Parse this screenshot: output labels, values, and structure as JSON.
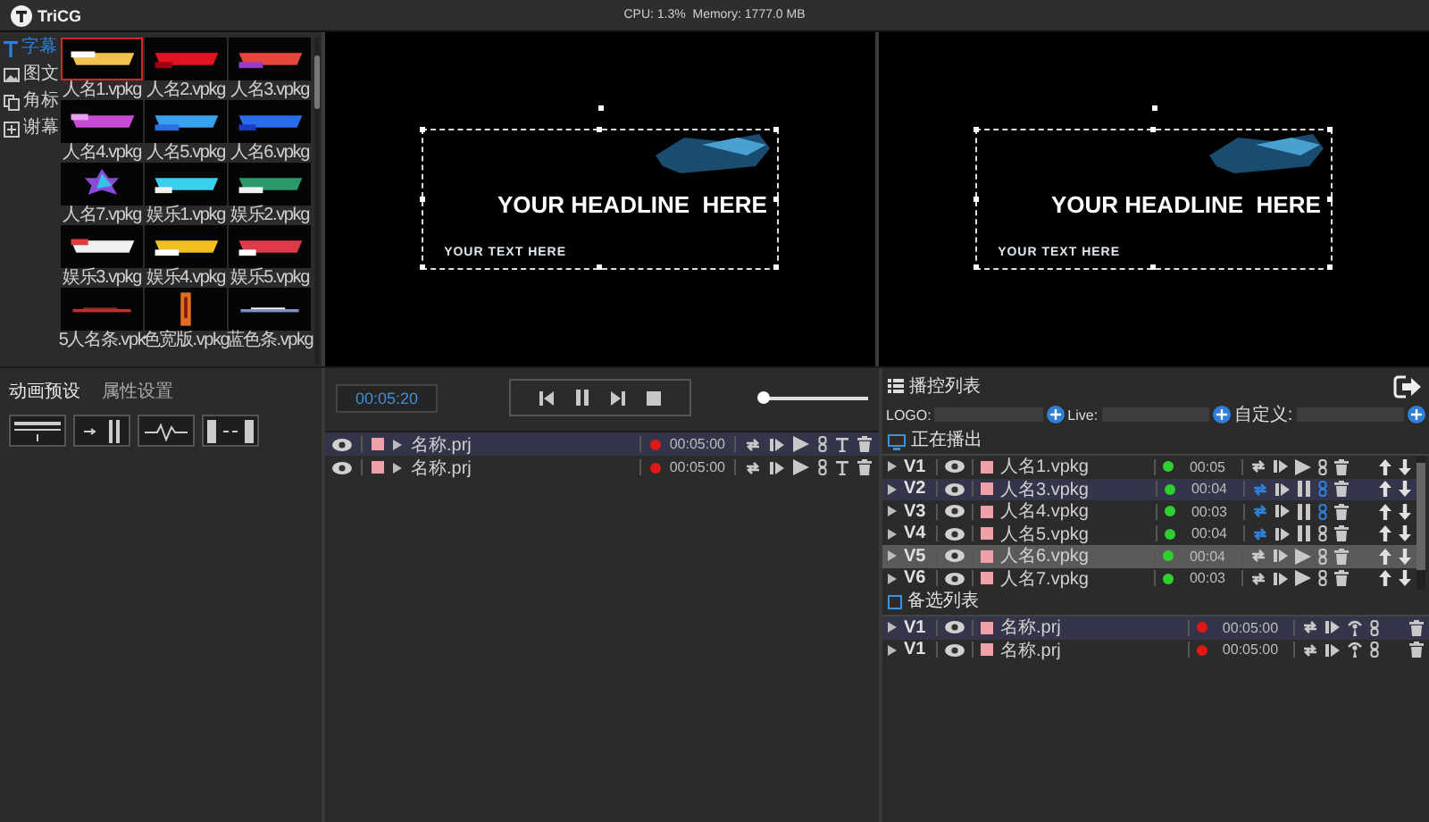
{
  "app": {
    "name": "TriCG",
    "status": "CPU: 1.3%  Memory: 1777.0 MB"
  },
  "library": {
    "tabs": [
      {
        "label": "字幕",
        "selected": true
      },
      {
        "label": "图文",
        "selected": false
      },
      {
        "label": "角标",
        "selected": false
      },
      {
        "label": "谢幕",
        "selected": false
      }
    ],
    "templates": [
      {
        "name": "人名1.vpkg",
        "selected": true
      },
      {
        "name": "人名2.vpkg",
        "selected": false
      },
      {
        "name": "人名3.vpkg",
        "selected": false
      },
      {
        "name": "人名4.vpkg",
        "selected": false
      },
      {
        "name": "人名5.vpkg",
        "selected": false
      },
      {
        "name": "人名6.vpkg",
        "selected": false
      },
      {
        "name": "人名7.vpkg",
        "selected": false
      },
      {
        "name": "娱乐1.vpkg",
        "selected": false
      },
      {
        "name": "娱乐2.vpkg",
        "selected": false
      },
      {
        "name": "娱乐3.vpkg",
        "selected": false
      },
      {
        "name": "娱乐4.vpkg",
        "selected": false
      },
      {
        "name": "娱乐5.vpkg",
        "selected": false
      },
      {
        "name": "5人名条.vpk",
        "selected": false
      },
      {
        "name": "色宽版.vpkg",
        "selected": false
      },
      {
        "name": "蓝色条.vpkg",
        "selected": false
      }
    ]
  },
  "previews": [
    {
      "headline": "YOUR HEADLINE  HERE",
      "subtitle": "YOUR TEXT HERE"
    },
    {
      "headline": "YOUR HEADLINE  HERE",
      "subtitle": "YOUR TEXT HERE"
    }
  ],
  "animation_panel": {
    "tabs": [
      {
        "label": "动画预设",
        "selected": true
      },
      {
        "label": "属性设置",
        "selected": false
      }
    ]
  },
  "timeline": {
    "time": "00:05:20",
    "volume": {
      "level": 0
    },
    "rows": [
      {
        "name": "名称.prj",
        "duration": "00:05:00",
        "focused": true
      },
      {
        "name": "名称.prj",
        "duration": "00:05:00",
        "focused": false
      }
    ]
  },
  "playlist": {
    "title": "播控列表",
    "fields": [
      {
        "label": "LOGO:"
      },
      {
        "label": "Live:"
      },
      {
        "label": "自定义:"
      }
    ],
    "on_air": {
      "title": "正在播出",
      "rows": [
        {
          "layer": "V1",
          "name": "人名1.vpkg",
          "time": "00:05",
          "playing": false,
          "loop": false,
          "linked": false,
          "selected": false,
          "focused": false
        },
        {
          "layer": "V2",
          "name": "人名3.vpkg",
          "time": "00:04",
          "playing": true,
          "loop": true,
          "linked": true,
          "selected": false,
          "focused": true
        },
        {
          "layer": "V3",
          "name": "人名4.vpkg",
          "time": "00:03",
          "playing": true,
          "loop": true,
          "linked": true,
          "selected": false,
          "focused": false
        },
        {
          "layer": "V4",
          "name": "人名5.vpkg",
          "time": "00:04",
          "playing": true,
          "loop": true,
          "linked": false,
          "selected": false,
          "focused": false
        },
        {
          "layer": "V5",
          "name": "人名6.vpkg",
          "time": "00:04",
          "playing": false,
          "loop": false,
          "linked": false,
          "selected": true,
          "focused": false
        },
        {
          "layer": "V6",
          "name": "人名7.vpkg",
          "time": "00:03",
          "playing": false,
          "loop": false,
          "linked": false,
          "selected": false,
          "focused": false
        }
      ]
    },
    "backup": {
      "title": "备选列表",
      "checked": false,
      "rows": [
        {
          "layer": "V1",
          "name": "名称.prj",
          "time": "00:05:00",
          "focused": true
        },
        {
          "layer": "V1",
          "name": "名称.prj",
          "time": "00:05:00",
          "focused": false
        }
      ]
    }
  }
}
